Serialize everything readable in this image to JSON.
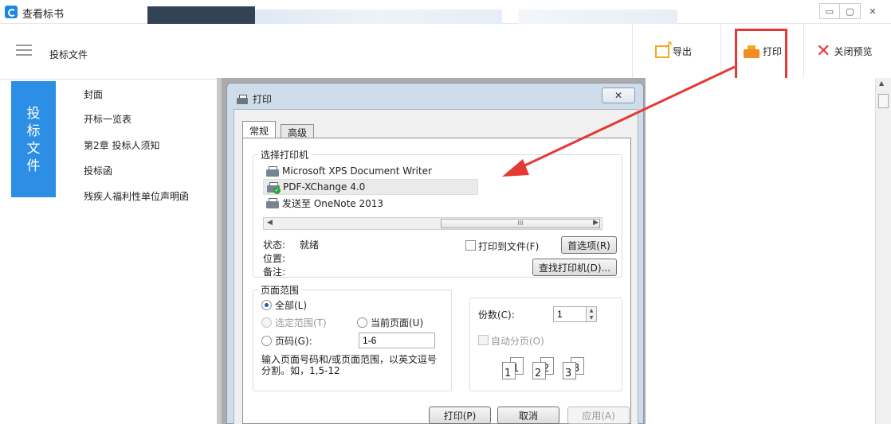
{
  "window": {
    "title": "查看标书",
    "controls": [
      "▭",
      "▢",
      "✕"
    ]
  },
  "toolbar": {
    "doc_title": "投标文件",
    "export_label": "导出",
    "print_label": "打印",
    "close_preview_label": "关闭预览"
  },
  "sidebar": {
    "tab_chars": [
      "投",
      "标",
      "文",
      "件"
    ],
    "items": [
      {
        "label": "封面"
      },
      {
        "label": "开标一览表"
      },
      {
        "label": "第2章 投标人须知"
      },
      {
        "label": "投标函"
      },
      {
        "label": "残疾人福利性单位声明函"
      }
    ]
  },
  "dialog": {
    "title": "打印",
    "close_glyph": "✕",
    "tabs": [
      "常规",
      "高级"
    ],
    "select_printer": {
      "legend": "选择打印机",
      "printers": [
        {
          "name": "Microsoft XPS Document Writer",
          "selected": false
        },
        {
          "name": "PDF-XChange 4.0",
          "selected": true
        },
        {
          "name": "发送至 OneNote 2013",
          "selected": false
        }
      ],
      "hscroll_left": "◀",
      "hscroll_thumb": "III",
      "hscroll_right": "▶"
    },
    "status_label": "状态:",
    "status_value": "就绪",
    "location_label": "位置:",
    "comment_label": "备注:",
    "print_to_file_label": "打印到文件(F)",
    "preferences_label": "首选项(R)",
    "find_printer_label": "查找打印机(D)...",
    "page_range": {
      "legend": "页面范围",
      "all_label": "全部(L)",
      "selection_label": "选定范围(T)",
      "current_page_label": "当前页面(U)",
      "pages_label": "页码(G):",
      "pages_value": "1-6",
      "hint": "输入页面号码和/或页面范围，以英文逗号分割。如，1,5-12"
    },
    "copies_label": "份数(C):",
    "copies_value": "1",
    "collate_label": "自动分页(O)",
    "collate_pages": [
      "1",
      "1",
      "2",
      "2",
      "3",
      "3"
    ],
    "print_button": "打印(P)",
    "cancel_button": "取消",
    "apply_button": "应用(A)"
  },
  "colors": {
    "accent_blue": "#2d8ee6",
    "annotation_red": "#e53935",
    "icon_orange": "#f5a623"
  }
}
